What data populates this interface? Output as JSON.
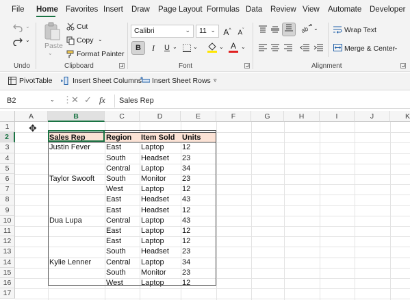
{
  "menu": {
    "tabs": [
      "File",
      "Home",
      "Favorites",
      "Insert",
      "Draw",
      "Page Layout",
      "Formulas",
      "Data",
      "Review",
      "View",
      "Automate",
      "Developer"
    ],
    "active_tab": "Home"
  },
  "ribbon": {
    "undo_group_label": "Undo",
    "clipboard": {
      "label": "Clipboard",
      "paste": "Paste",
      "cut": "Cut",
      "copy": "Copy",
      "format_painter": "Format Painter"
    },
    "font": {
      "label": "Font",
      "font_name": "Calibri",
      "font_size": "11",
      "grow_label": "A",
      "shrink_label": "A",
      "bold": "B",
      "italic": "I",
      "underline": "U",
      "font_color_label": "A"
    },
    "alignment": {
      "label": "Alignment",
      "wrap_text": "Wrap Text",
      "merge_center": "Merge & Center"
    }
  },
  "quickbar": {
    "pivot_table": "PivotTable",
    "insert_sheet_columns": "Insert Sheet Columns",
    "insert_sheet_rows": "Insert Sheet Rows"
  },
  "formula_bar": {
    "name_box": "B2",
    "fx": "fx",
    "content": "Sales Rep"
  },
  "sheet": {
    "columns": [
      "A",
      "B",
      "C",
      "D",
      "E",
      "F",
      "G",
      "H",
      "I",
      "J",
      "K"
    ],
    "rows": [
      "1",
      "2",
      "3",
      "4",
      "5",
      "6",
      "7",
      "8",
      "9",
      "10",
      "11",
      "12",
      "13",
      "14",
      "15",
      "16",
      "17"
    ],
    "table_headers": [
      "Sales Rep",
      "Region",
      "Item Sold",
      "Units"
    ],
    "table_rows": [
      [
        "Justin Fever",
        "East",
        "Laptop",
        "12"
      ],
      [
        "",
        "South",
        "Headset",
        "23"
      ],
      [
        "",
        "Central",
        "Laptop",
        "34"
      ],
      [
        "Taylor Swooft",
        "South",
        "Monitor",
        "23"
      ],
      [
        "",
        "West",
        "Laptop",
        "12"
      ],
      [
        "",
        "East",
        "Headset",
        "43"
      ],
      [
        "",
        "East",
        "Headset",
        "12"
      ],
      [
        "Dua Lupa",
        "Central",
        "Laptop",
        "43"
      ],
      [
        "",
        "East",
        "Laptop",
        "12"
      ],
      [
        "",
        "East",
        "Laptop",
        "12"
      ],
      [
        "",
        "South",
        "Headset",
        "23"
      ],
      [
        "Kylie Lenner",
        "Central",
        "Laptop",
        "34"
      ],
      [
        "",
        "South",
        "Monitor",
        "23"
      ],
      [
        "",
        "West",
        "Laptop",
        "12"
      ]
    ]
  },
  "colors": {
    "accent": "#1a7343",
    "header_fill": "#fbe2d5",
    "font_color_bar": "#e02020",
    "highlight_bar": "#ffe600"
  }
}
